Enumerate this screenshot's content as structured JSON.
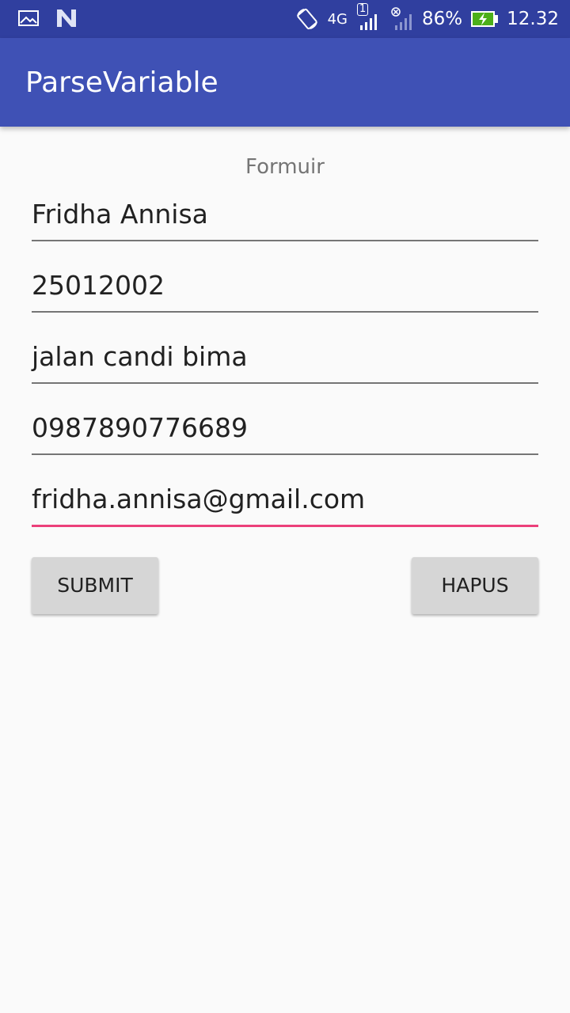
{
  "status_bar": {
    "network": "4G",
    "sim": "1",
    "battery": "86%",
    "time": "12.32",
    "icons": [
      "gallery-icon",
      "n-icon",
      "rotate-icon",
      "signal-icon",
      "no-sim-icon",
      "battery-charging-icon"
    ]
  },
  "app": {
    "title": "ParseVariable"
  },
  "form": {
    "heading": "Formuir",
    "fields": [
      "Fridha Annisa",
      "25012002",
      "jalan candi bima",
      "0987890776689",
      "fridha.annisa@gmail.com"
    ],
    "submit_label": "SUBMIT",
    "clear_label": "HAPUS"
  },
  "colors": {
    "status_bar": "#303f9f",
    "app_bar": "#3f51b5",
    "accent": "#ec407a",
    "button": "#d6d6d6"
  }
}
